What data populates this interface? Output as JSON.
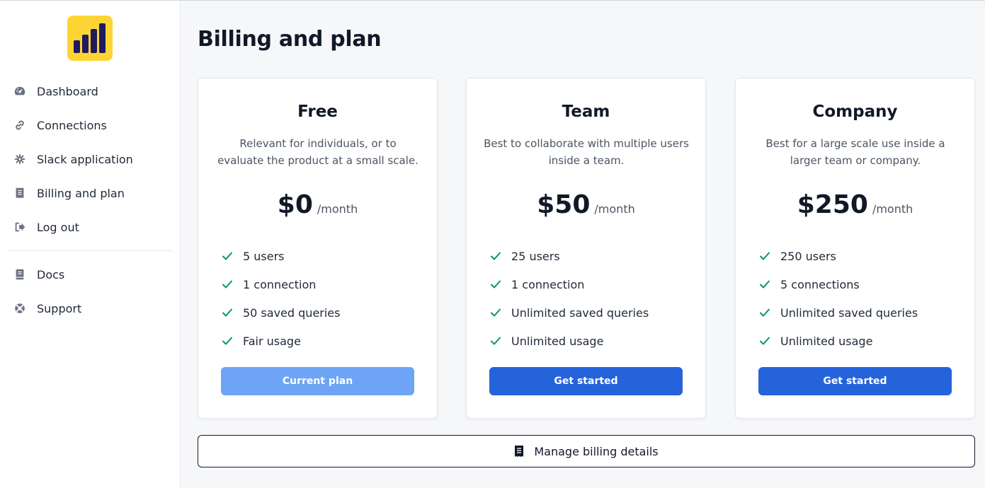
{
  "sidebar": {
    "nav": [
      {
        "label": "Dashboard",
        "icon": "gauge-icon"
      },
      {
        "label": "Connections",
        "icon": "link-icon"
      },
      {
        "label": "Slack application",
        "icon": "gear-icon"
      },
      {
        "label": "Billing and plan",
        "icon": "receipt-icon"
      },
      {
        "label": "Log out",
        "icon": "logout-icon"
      }
    ],
    "secondary": [
      {
        "label": "Docs",
        "icon": "book-icon"
      },
      {
        "label": "Support",
        "icon": "lifebuoy-icon"
      }
    ]
  },
  "main": {
    "title": "Billing and plan",
    "plans": [
      {
        "name": "Free",
        "description": "Relevant for individuals, or to evaluate the product at a small scale.",
        "price": "$0",
        "period": "/month",
        "features": [
          "5 users",
          "1 connection",
          "50 saved queries",
          "Fair usage"
        ],
        "button": "Current plan"
      },
      {
        "name": "Team",
        "description": "Best to collaborate with multiple users inside a team.",
        "price": "$50",
        "period": "/month",
        "features": [
          "25 users",
          "1 connection",
          "Unlimited saved queries",
          "Unlimited usage"
        ],
        "button": "Get started"
      },
      {
        "name": "Company",
        "description": "Best for a large scale use inside a larger team or company.",
        "price": "$250",
        "period": "/month",
        "features": [
          "250 users",
          "5 connections",
          "Unlimited saved queries",
          "Unlimited usage"
        ],
        "button": "Get started"
      }
    ],
    "manage_billing": "Manage billing details"
  },
  "colors": {
    "accent": "#2563db",
    "accent_disabled": "#6ea4f5",
    "check": "#059669",
    "logo_bg": "#fcd535",
    "logo_bars": "#1e1b5e"
  }
}
